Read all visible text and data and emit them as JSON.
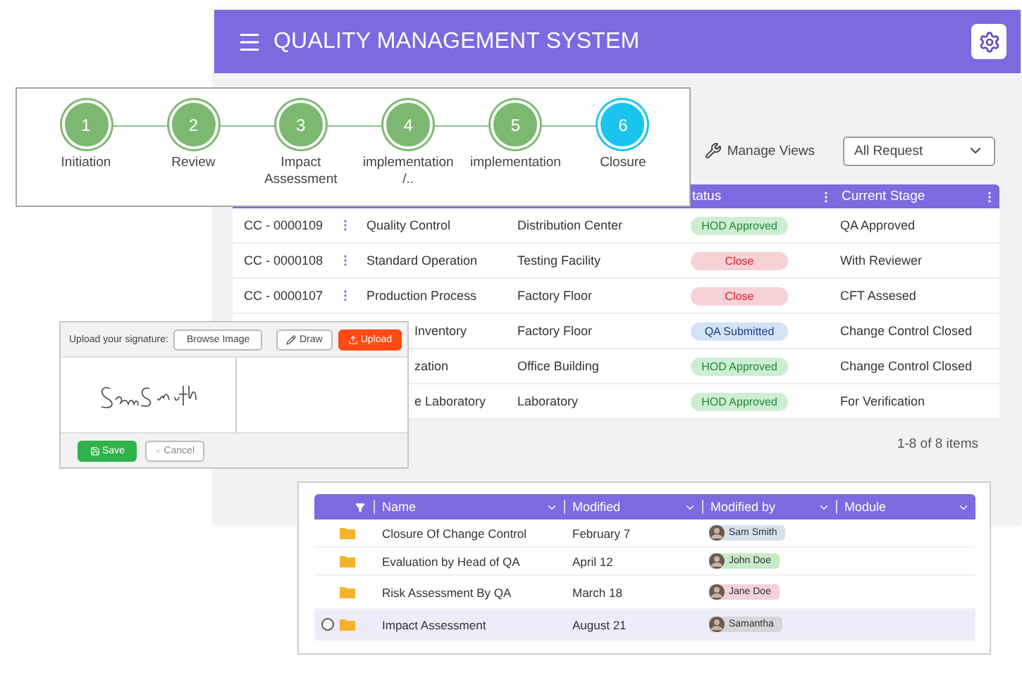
{
  "app": {
    "title": "QUALITY MANAGEMENT SYSTEM"
  },
  "toolbar": {
    "manage_views": "Manage Views",
    "filter": {
      "value": "All Request"
    }
  },
  "table": {
    "columns": [
      "tatus",
      "Current Stage"
    ],
    "rows": [
      {
        "id": "CC - 0000109",
        "name": "Quality Control",
        "location": "Distribution Center",
        "status": {
          "label": "HOD Approved",
          "kind": "success"
        },
        "stage": "QA Approved"
      },
      {
        "id": "CC - 0000108",
        "name": "Standard Operation",
        "location": "Testing Facility",
        "status": {
          "label": "Close",
          "kind": "danger"
        },
        "stage": "With Reviewer"
      },
      {
        "id": "CC - 0000107",
        "name": "Production Process",
        "location": "Factory Floor",
        "status": {
          "label": "Close",
          "kind": "danger"
        },
        "stage": "CFT Assesed"
      },
      {
        "name": "Inventory",
        "location": "Factory Floor",
        "status": {
          "label": "QA Submitted",
          "kind": "info"
        },
        "stage": "Change Control Closed"
      },
      {
        "name": "zation",
        "location": "Office Building",
        "status": {
          "label": "HOD Approved",
          "kind": "success"
        },
        "stage": "Change Control Closed"
      },
      {
        "name": "e Laboratory",
        "location": "Laboratory",
        "status": {
          "label": "HOD Approved",
          "kind": "success"
        },
        "stage": "For Verification"
      }
    ],
    "pagination": "1-8 of 8 items"
  },
  "stepper": {
    "steps": [
      {
        "number": "1",
        "label": "Initiation",
        "current": false
      },
      {
        "number": "2",
        "label": "Review",
        "current": false
      },
      {
        "number": "3",
        "label": "Impact Assessment",
        "current": false
      },
      {
        "number": "4",
        "label": "implementation /..",
        "current": false
      },
      {
        "number": "5",
        "label": "implementation",
        "current": false
      },
      {
        "number": "6",
        "label": "Closure",
        "current": true
      }
    ]
  },
  "signature": {
    "label": "Upload your signature:",
    "browse": "Browse Image",
    "draw": "Draw",
    "upload": "Upload",
    "save": "Save",
    "cancel": "Cancel"
  },
  "files": {
    "columns": [
      "Name",
      "Modified",
      "Modified by",
      "Module"
    ],
    "rows": [
      {
        "name": "Closure Of Change Control",
        "modified": "February 7",
        "user": "Sam Smith",
        "color": "#d8e1ea",
        "selected": false
      },
      {
        "name": "Evaluation by Head of QA",
        "modified": "April 12",
        "user": "John Doe",
        "color": "#c6ebc6",
        "selected": false
      },
      {
        "name": "Risk Assessment By QA",
        "modified": "March 18",
        "user": "Jane Doe",
        "color": "#f1d2da",
        "selected": false
      },
      {
        "name": "Impact Assessment",
        "modified": "August 21",
        "user": "Samantha",
        "color": "#d6d6d8",
        "selected": true
      }
    ]
  }
}
